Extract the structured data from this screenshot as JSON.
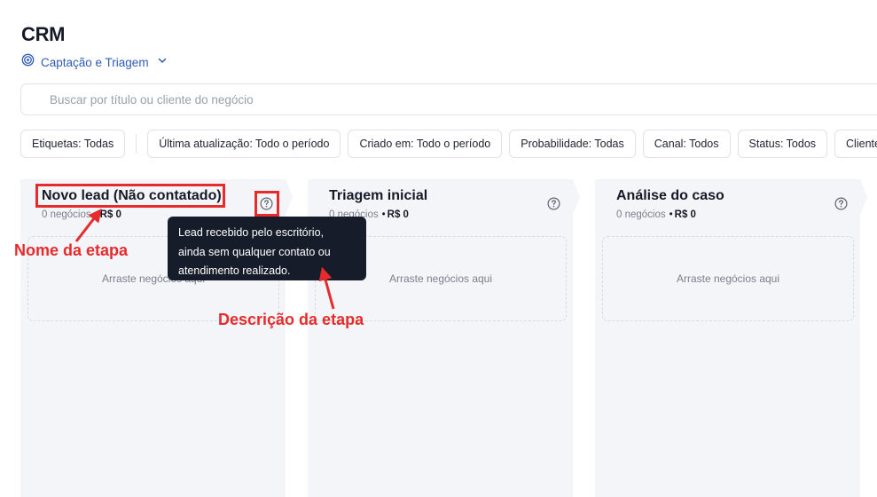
{
  "page": {
    "title": "CRM",
    "pipeline_label": "Captação e Triagem"
  },
  "search": {
    "placeholder": "Buscar por título ou cliente do negócio"
  },
  "filters": {
    "tags": "Etiquetas: Todas",
    "updated": "Última atualização: Todo o período",
    "created": "Criado em: Todo o período",
    "probability": "Probabilidade: Todas",
    "channel": "Canal: Todos",
    "status": "Status: Todos",
    "client": "Cliente"
  },
  "columns": [
    {
      "name": "Novo lead (Não contatado)",
      "count": "0 negócios",
      "amount": "R$ 0",
      "drop": "Arraste negócios aqui"
    },
    {
      "name": "Triagem inicial",
      "count": "0 negócios",
      "amount": "R$ 0",
      "drop": "Arraste negócios aqui"
    },
    {
      "name": "Análise do caso",
      "count": "0 negócios",
      "amount": "R$ 0",
      "drop": "Arraste negócios aqui"
    }
  ],
  "tooltip": {
    "line1": "Lead recebido pelo escritório,",
    "line2": "ainda sem qualquer contato ou",
    "line3": "atendimento realizado."
  },
  "annotations": {
    "stage_name": "Nome da etapa",
    "stage_description": "Descrição da etapa"
  },
  "colors": {
    "accent": "#2f5bb5",
    "annotation": "#e52b2b",
    "tooltip_bg": "#161c29",
    "column_bg": "#f4f5f9"
  }
}
